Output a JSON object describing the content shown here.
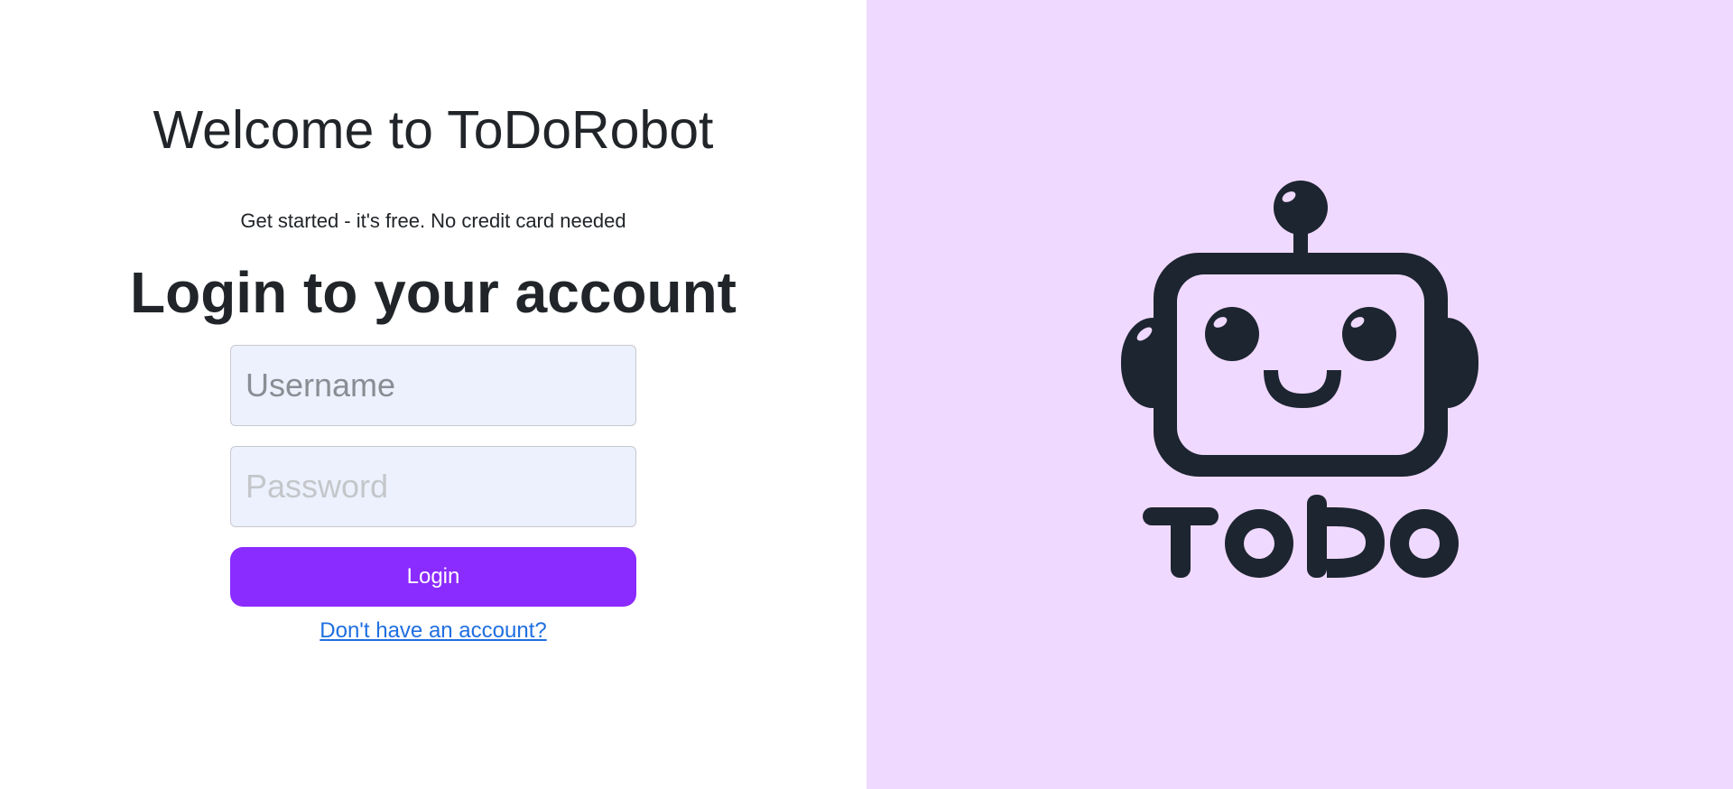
{
  "welcome": {
    "title": "Welcome to ToDoRobot"
  },
  "tagline": "Get started - it's free. No credit card needed",
  "login": {
    "heading": "Login to your account",
    "username_placeholder": "Username",
    "password_placeholder": "Password",
    "button_label": "Login",
    "signup_link": "Don't have an account?"
  },
  "logo": {
    "text": "To Do",
    "icon": "robot-logo-icon"
  },
  "colors": {
    "accent": "#8a2bff",
    "panel_background": "#f0d9fe",
    "input_background": "#ecf1fd",
    "link": "#1f6fe0",
    "logo_dark": "#1c2530"
  }
}
